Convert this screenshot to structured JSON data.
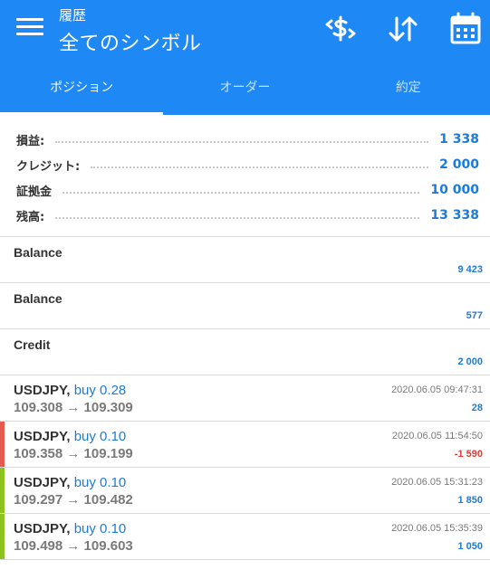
{
  "header": {
    "small_title": "履歴",
    "title": "全てのシンボル"
  },
  "tabs": [
    {
      "label": "ポジション",
      "active": true
    },
    {
      "label": "オーダー",
      "active": false
    },
    {
      "label": "約定",
      "active": false
    }
  ],
  "summary": [
    {
      "label": "損益:",
      "value": "1 338"
    },
    {
      "label": "クレジット:",
      "value": "2 000"
    },
    {
      "label": "証拠金",
      "value": "10 000"
    },
    {
      "label": "残高:",
      "value": "13 338"
    }
  ],
  "operations": [
    {
      "title": "Balance",
      "amount": "9 423"
    },
    {
      "title": "Balance",
      "amount": "577"
    },
    {
      "title": "Credit",
      "amount": "2 000"
    }
  ],
  "trades": [
    {
      "symbol": "USDJPY,",
      "side": "buy 0.28",
      "prices": "109.308 → 109.309",
      "time": "2020.06.05 09:47:31",
      "profit": "28"
    },
    {
      "symbol": "USDJPY,",
      "side": "buy 0.10",
      "prices": "109.358 → 109.199",
      "time": "2020.06.05 11:54:50",
      "profit": "-1 590"
    },
    {
      "symbol": "USDJPY,",
      "side": "buy 0.10",
      "prices": "109.297 → 109.482",
      "time": "2020.06.05 15:31:23",
      "profit": "1 850"
    },
    {
      "symbol": "USDJPY,",
      "side": "buy 0.10",
      "prices": "109.498 → 109.603",
      "time": "2020.06.05 15:35:39",
      "profit": "1 050"
    }
  ],
  "icons": {
    "menu": "menu-icon",
    "currency": "currency-exchange-icon",
    "sort": "sort-icon",
    "calendar": "calendar-icon"
  },
  "colors": {
    "header_bg": "#1e88f5",
    "accent_blue": "#1e7ad8",
    "loss_red": "#e53935",
    "loss_bar": "#e35b4f",
    "profit_bar": "#8dc21f"
  }
}
